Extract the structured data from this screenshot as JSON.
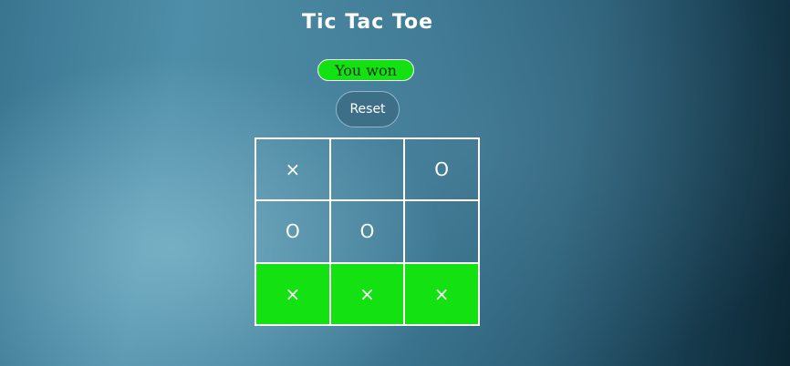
{
  "game": {
    "title": "Tic Tac Toe",
    "status": "You won",
    "reset_label": "Reset",
    "board": [
      "×",
      "",
      "O",
      "O",
      "O",
      "",
      "×",
      "×",
      "×"
    ],
    "winning_cells": [
      6,
      7,
      8
    ]
  },
  "colors": {
    "win_highlight": "#13e112",
    "status_badge": "#13e112",
    "reset_button": "#3d6f88",
    "grid_lines": "#ffffff"
  }
}
